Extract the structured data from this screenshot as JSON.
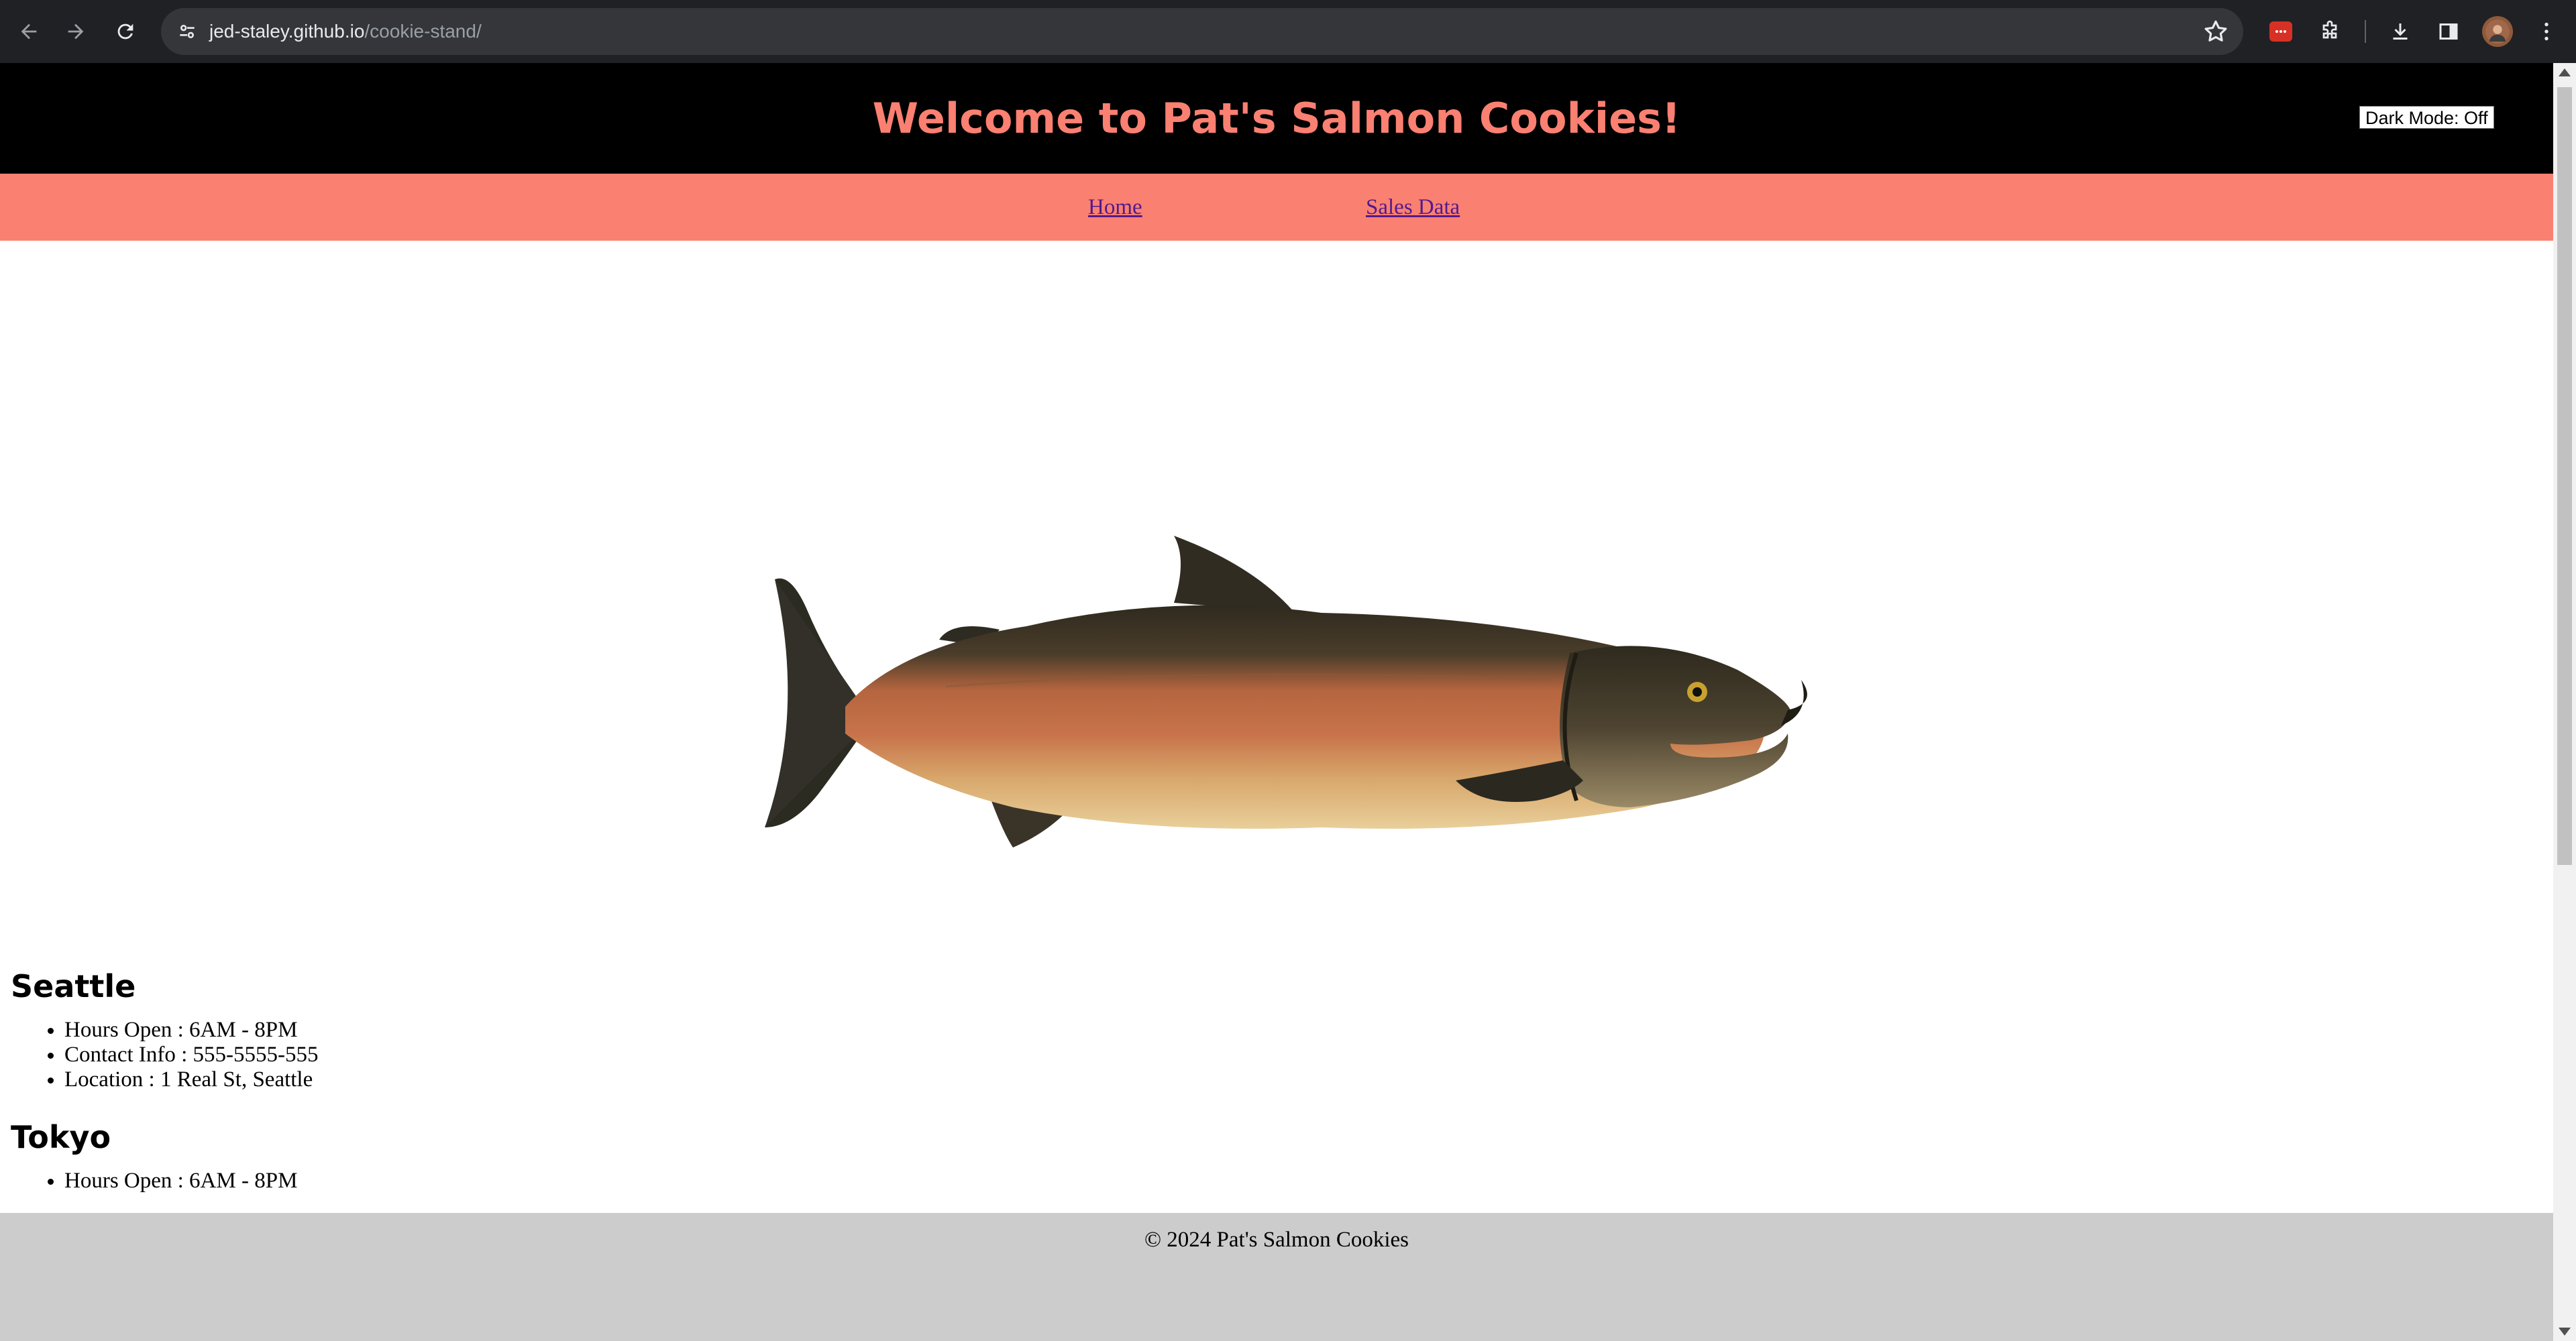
{
  "browser": {
    "url_host": "jed-staley.github.io",
    "url_path": "/cookie-stand/"
  },
  "header": {
    "title": "Welcome to Pat's Salmon Cookies!",
    "dark_mode_label": "Dark Mode: Off"
  },
  "nav": {
    "items": [
      {
        "label": "Home"
      },
      {
        "label": "Sales Data"
      }
    ]
  },
  "stores": [
    {
      "name": "Seattle",
      "details": [
        "Hours Open : 6AM - 8PM",
        "Contact Info : 555-5555-555",
        "Location : 1 Real St, Seattle"
      ]
    },
    {
      "name": "Tokyo",
      "details": [
        "Hours Open : 6AM - 8PM"
      ]
    }
  ],
  "footer": {
    "text": "© 2024 Pat's Salmon Cookies"
  },
  "colors": {
    "header_bg": "#000000",
    "title": "#fa8072",
    "nav_bg": "#fa8072",
    "footer_bg": "#cccccc",
    "chrome_bg": "#202124"
  }
}
